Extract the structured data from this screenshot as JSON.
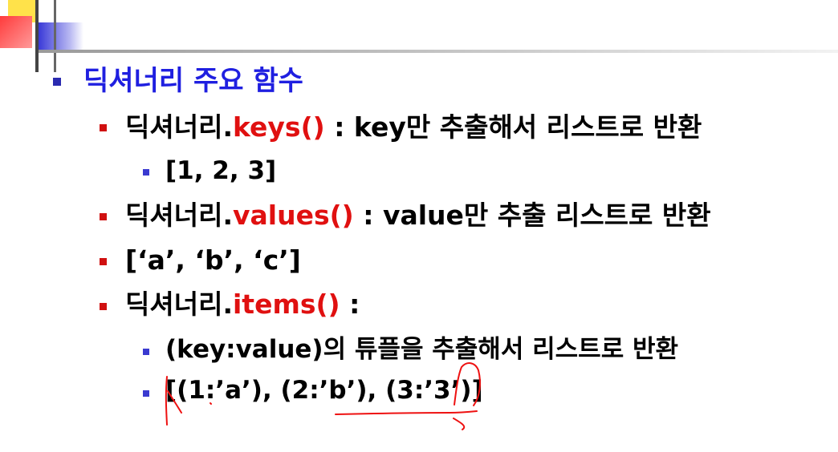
{
  "slide": {
    "title": "딕셔너리 주요 함수",
    "lines": [
      {
        "level": 2,
        "prefix": "딕셔너리.",
        "method": "keys()",
        "suffix": " : key만 추출해서 리스트로 반환"
      },
      {
        "level": 3,
        "text": "[1, 2, 3]"
      },
      {
        "level": 2,
        "prefix": "딕셔너리.",
        "method": "values()",
        "suffix": " : value만 추출 리스트로 반환"
      },
      {
        "level": 2,
        "text": "[‘a’, ‘b’, ‘c’]"
      },
      {
        "level": 2,
        "prefix": "딕셔너리.",
        "method": "items()",
        "suffix": " :"
      },
      {
        "level": 3,
        "text": "(key:value)의 튜플을 추출해서 리스트로 반환"
      },
      {
        "level": 3,
        "text": "[(1:’a’), (2:’b’), (3:’3’)]"
      }
    ]
  },
  "colors": {
    "title": "#1f1fe0",
    "method": "#e01010",
    "bullet_level1": "#2a2ab0",
    "bullet_level2": "#d01010",
    "bullet_level3": "#3a3ad0",
    "annotation_ink": "#ee1111"
  }
}
